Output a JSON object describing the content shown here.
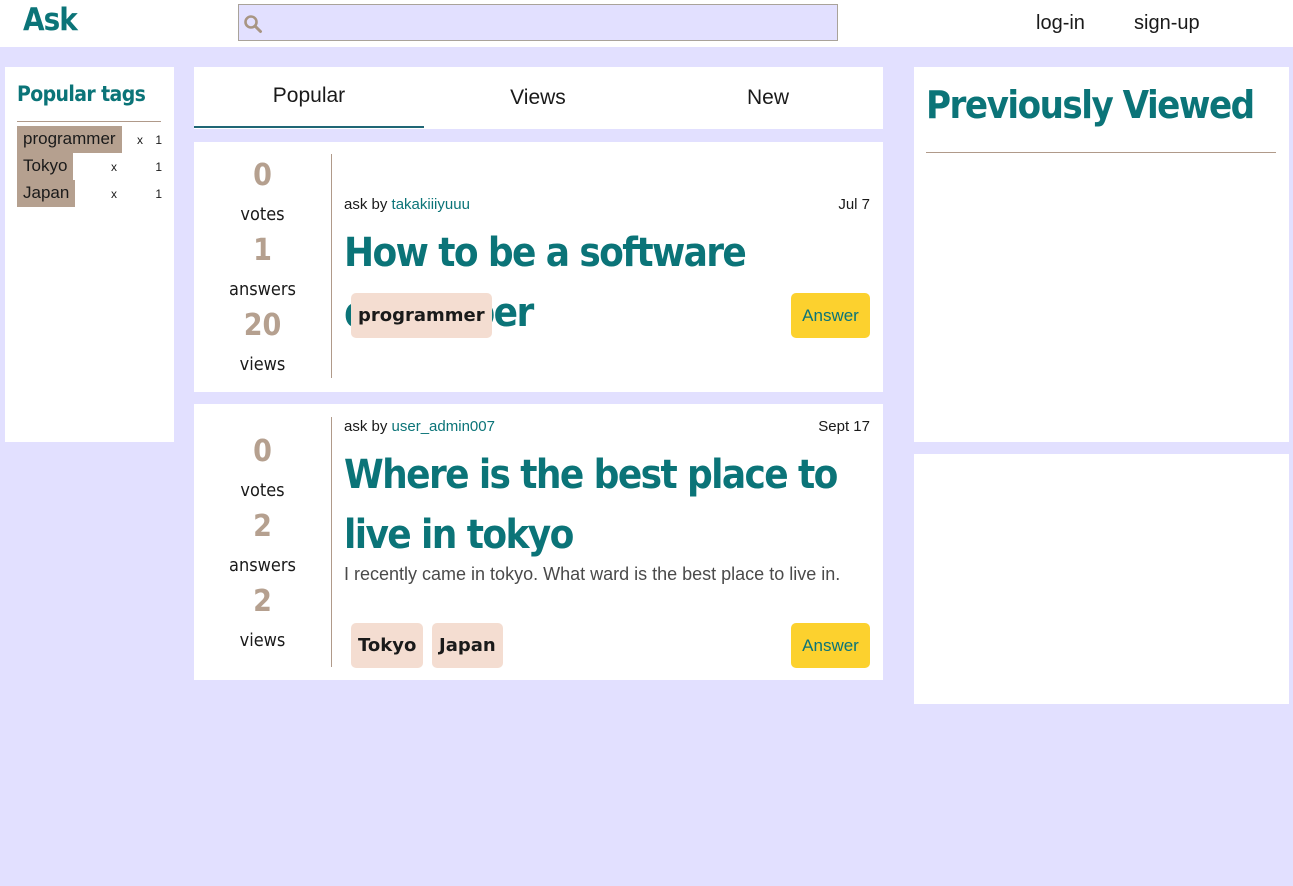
{
  "header": {
    "logo": "Ask",
    "search_placeholder": "",
    "login_label": "log-in",
    "signup_label": "sign-up"
  },
  "popular_tags": {
    "title": "Popular tags",
    "items": [
      {
        "name": "programmer",
        "remove": "x",
        "count": "1"
      },
      {
        "name": "Tokyo",
        "remove": "x",
        "count": "1"
      },
      {
        "name": "Japan",
        "remove": "x",
        "count": "1"
      }
    ]
  },
  "tabs": [
    {
      "label": "Popular",
      "active": true
    },
    {
      "label": "Views",
      "active": false
    },
    {
      "label": "New",
      "active": false
    }
  ],
  "questions": [
    {
      "votes": "0",
      "votes_label": "votes",
      "answers": "1",
      "answers_label": "answers",
      "views": "20",
      "views_label": "views",
      "ask_prefix": "ask by",
      "author": "takakiiiyuuu",
      "date": "Jul 7",
      "title": "How to be a software developer",
      "excerpt": "",
      "tags": [
        "programmer"
      ],
      "answer_label": "Answer"
    },
    {
      "votes": "0",
      "votes_label": "votes",
      "answers": "2",
      "answers_label": "answers",
      "views": "2",
      "views_label": "views",
      "ask_prefix": "ask by",
      "author": "user_admin007",
      "date": "Sept 17",
      "title": "Where is the best place to live in tokyo",
      "excerpt": "I recently came in tokyo. What ward is the best place to live in.",
      "tags": [
        "Tokyo",
        "Japan"
      ],
      "answer_label": "Answer"
    }
  ],
  "previously_viewed": {
    "title": "Previously Viewed"
  },
  "colors": {
    "accent": "#0b7478",
    "background": "#e2e0ff",
    "tag_chip": "#b5a08f",
    "question_tag": "#f4ddd1",
    "answer_button": "#fcd12e"
  }
}
